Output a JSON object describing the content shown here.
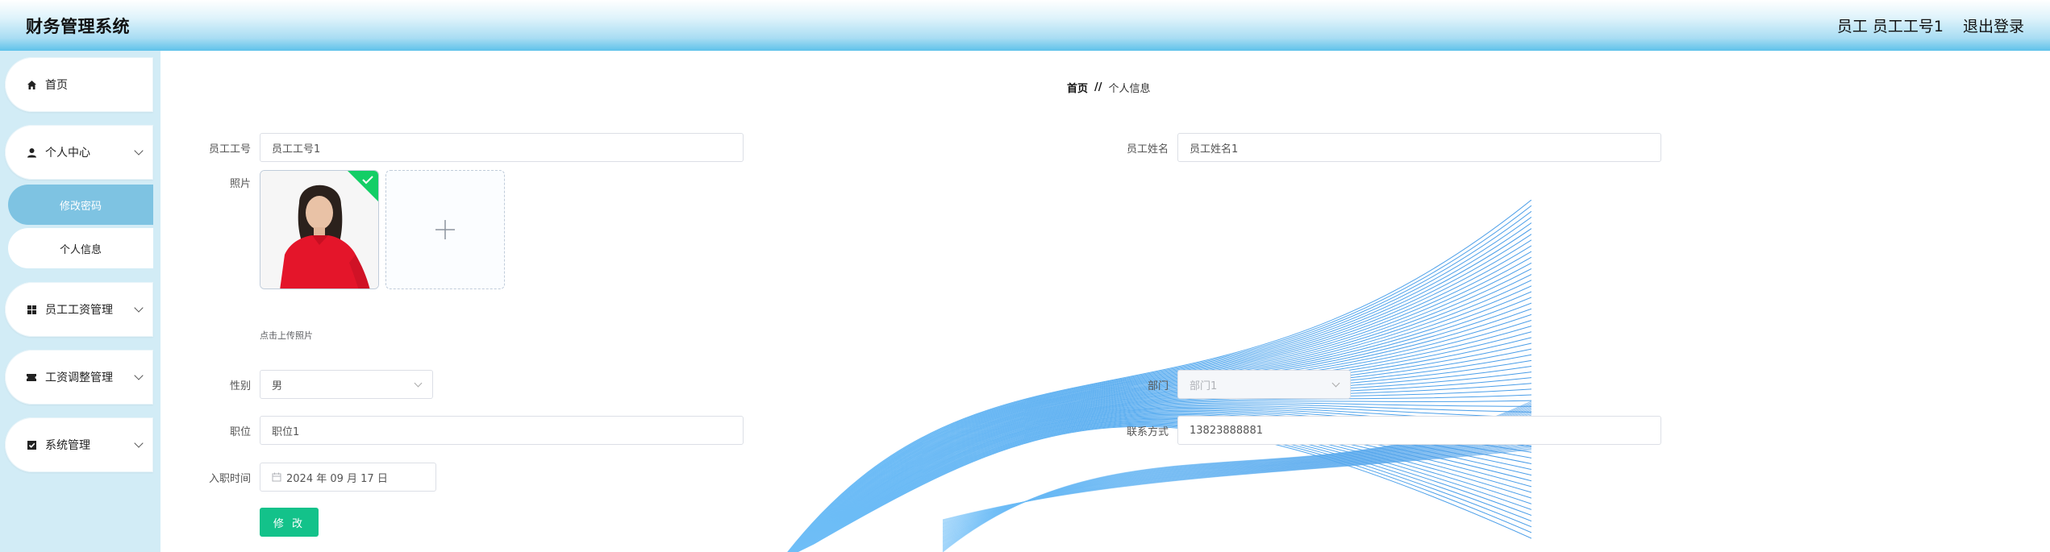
{
  "header": {
    "title": "财务管理系统",
    "user_label": "员工 员工工号1",
    "logout_label": "退出登录"
  },
  "sidebar": {
    "items": [
      {
        "label": "首页",
        "icon": "home-icon"
      },
      {
        "label": "个人中心",
        "icon": "user-icon",
        "expanded": true,
        "children": [
          {
            "label": "修改密码",
            "active": true
          },
          {
            "label": "个人信息",
            "active": false
          }
        ]
      },
      {
        "label": "员工工资管理",
        "icon": "grid-icon"
      },
      {
        "label": "工资调整管理",
        "icon": "ticket-icon"
      },
      {
        "label": "系统管理",
        "icon": "checkbox-icon"
      }
    ]
  },
  "breadcrumb": {
    "home": "首页",
    "separator": "//",
    "current": "个人信息"
  },
  "form": {
    "emp_no_label": "员工工号",
    "emp_no_value": "员工工号1",
    "emp_name_label": "员工姓名",
    "emp_name_value": "员工姓名1",
    "photo_label": "照片",
    "upload_hint": "点击上传照片",
    "gender_label": "性别",
    "gender_value": "男",
    "dept_label": "部门",
    "dept_value": "部门1",
    "position_label": "职位",
    "position_value": "职位1",
    "contact_label": "联系方式",
    "contact_value": "13823888881",
    "hire_date_label": "入职时间",
    "hire_date_value": "2024 年 09 月 17 日",
    "submit_label": "修 改"
  },
  "colors": {
    "accent": "#13c28a",
    "sidebar_bg": "#d2ecf6",
    "sidebar_active": "#7ec3e2",
    "header_blue": "#5fc2ea",
    "upload_success": "#13ce66"
  }
}
